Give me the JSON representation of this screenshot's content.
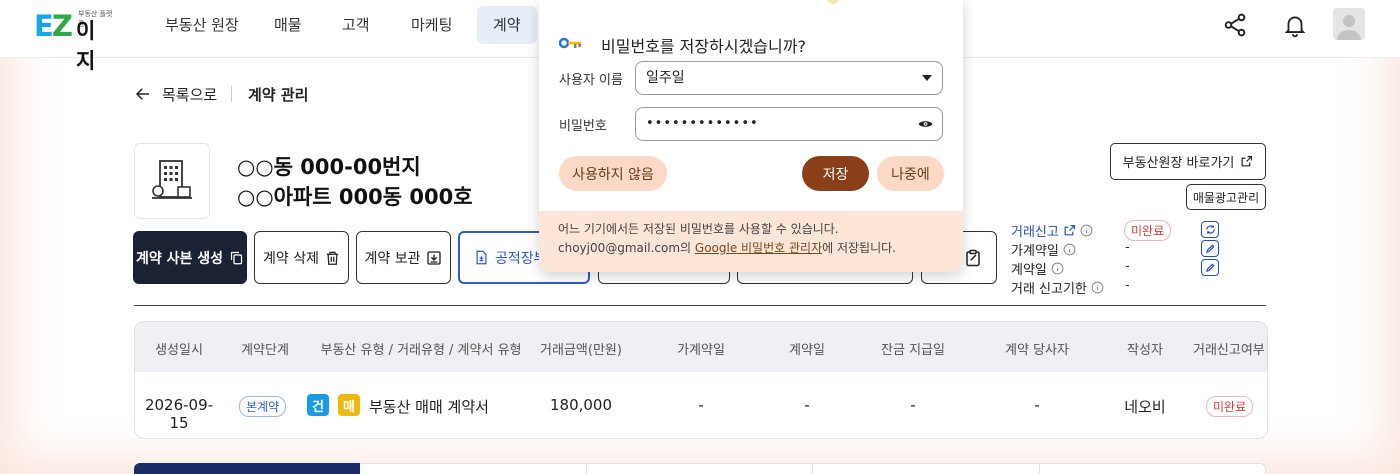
{
  "logo": {
    "ez": "EZ",
    "ij": "이지",
    "tag": "부동산 플랫폼"
  },
  "nav": [
    {
      "label": "부동산 원장"
    },
    {
      "label": "매물"
    },
    {
      "label": "고객"
    },
    {
      "label": "마케팅"
    },
    {
      "label": "계약",
      "active": true
    }
  ],
  "breadcrumb": {
    "back": "목록으로",
    "current": "계약 관리"
  },
  "property": {
    "title1": "○○동 000-00번지",
    "title2": "○○아파트 000동 000호",
    "goto_ledger": "부동산원장 바로가기",
    "ad_manage": "매물광고관리"
  },
  "actions": {
    "copy": "계약 사본 생성",
    "delete": "계약 삭제",
    "archive": "계약 보관",
    "registry": "공적장부"
  },
  "status": {
    "report_label": "거래신고",
    "report_value": "미완료",
    "deposit_label": "가계약일",
    "deposit_value": "-",
    "contract_label": "계약일",
    "contract_value": "-",
    "deadline_label": "거래 신고기한",
    "deadline_value": "-"
  },
  "table": {
    "headers": [
      "생성일시",
      "계약단계",
      "부동산 유형 / 거래유형 / 계약서 유형",
      "거래금액(만원)",
      "가계약일",
      "계약일",
      "잔금 지급일",
      "계약 당사자",
      "작성자",
      "거래신고여부"
    ],
    "row": {
      "created": "2026-09-15",
      "stage": "본계약",
      "type_badge1": "건",
      "type_badge2": "매",
      "type_text": "부동산 매매 계약서",
      "amount": "180,000",
      "deposit_date": "-",
      "contract_date": "-",
      "balance_date": "-",
      "party": "-",
      "writer": "네오비",
      "report": "미완료"
    }
  },
  "popup": {
    "title": "비밀번호를 저장하시겠습니까?",
    "username_label": "사용자 이름",
    "username_value": "일주일",
    "password_label": "비밀번호",
    "password_value": "•••••••••••••",
    "never": "사용하지 않음",
    "save": "저장",
    "later": "나중에",
    "foot_line1": "어느 기기에서든 저장된 비밀번호를 사용할 수 있습니다.",
    "foot_email": "choyj00@gmail.com의 ",
    "foot_link": "Google 비밀번호 관리자",
    "foot_tail": "에 저장됩니다."
  },
  "colors": {
    "nav_active_bg": "#e8eef8",
    "dark_button": "#1b2233",
    "accent_blue": "#2c5bd6",
    "warn_red": "#d53b3b",
    "popup_save": "#8a3f18",
    "popup_light": "#fbd9c6",
    "popup_footer": "#fde5d8"
  },
  "icons": [
    "share-icon",
    "bell-icon",
    "avatar-icon",
    "arrow-left-icon",
    "building-icon",
    "external-link-icon",
    "copy-icon",
    "trash-icon",
    "archive-icon",
    "document-icon",
    "clipboard-icon",
    "info-icon",
    "refresh-icon",
    "edit-icon",
    "key-icon",
    "chevron-down-icon",
    "eye-icon"
  ]
}
